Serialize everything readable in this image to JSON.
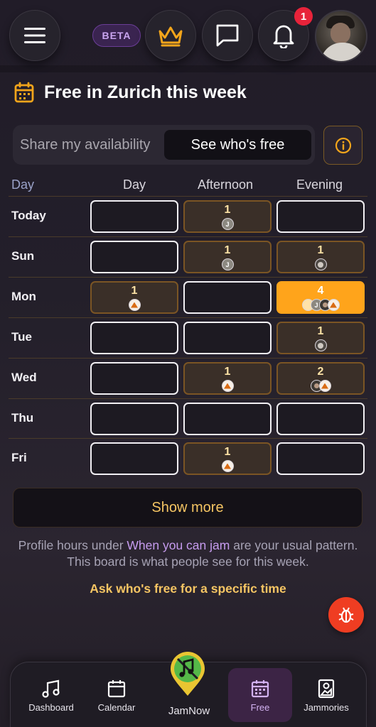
{
  "header": {
    "menu_icon": "hamburger-icon",
    "beta_label": "BETA",
    "crown_icon": "crown-icon",
    "chat_icon": "chat-icon",
    "bell_icon": "bell-icon",
    "notification_count": "1",
    "avatar_icon": "profile-avatar"
  },
  "page": {
    "title": "Free in Zurich this week",
    "title_icon": "calendar-icon"
  },
  "share": {
    "label": "Share my availability",
    "button": "See who's free",
    "info_icon": "info-icon"
  },
  "grid": {
    "headers": [
      "Day",
      "Day",
      "Afternoon",
      "Evening"
    ],
    "rows": [
      {
        "day": "Today",
        "cells": [
          {
            "count": "",
            "avatars": []
          },
          {
            "count": "1",
            "avatars": [
              "J"
            ]
          },
          {
            "count": "",
            "avatars": []
          }
        ]
      },
      {
        "day": "Sun",
        "cells": [
          {
            "count": "",
            "avatars": []
          },
          {
            "count": "1",
            "avatars": [
              "J"
            ]
          },
          {
            "count": "1",
            "avatars": [
              "dog"
            ]
          }
        ]
      },
      {
        "day": "Mon",
        "cells": [
          {
            "count": "1",
            "avatars": [
              "fox"
            ]
          },
          {
            "count": "",
            "avatars": []
          },
          {
            "count": "4",
            "avatars": [
              "blank",
              "J",
              "person",
              "fox"
            ],
            "highlight": true
          }
        ]
      },
      {
        "day": "Tue",
        "cells": [
          {
            "count": "",
            "avatars": []
          },
          {
            "count": "",
            "avatars": []
          },
          {
            "count": "1",
            "avatars": [
              "dog"
            ]
          }
        ]
      },
      {
        "day": "Wed",
        "cells": [
          {
            "count": "",
            "avatars": []
          },
          {
            "count": "1",
            "avatars": [
              "fox"
            ]
          },
          {
            "count": "2",
            "avatars": [
              "person",
              "fox"
            ]
          }
        ]
      },
      {
        "day": "Thu",
        "cells": [
          {
            "count": "",
            "avatars": []
          },
          {
            "count": "",
            "avatars": []
          },
          {
            "count": "",
            "avatars": []
          }
        ]
      },
      {
        "day": "Fri",
        "cells": [
          {
            "count": "",
            "avatars": []
          },
          {
            "count": "1",
            "avatars": [
              "fox"
            ]
          },
          {
            "count": "",
            "avatars": []
          }
        ]
      }
    ]
  },
  "show_more": "Show more",
  "note": {
    "pre": "Profile hours under ",
    "link": "When you can jam",
    "post": " are your usual pattern. This board is what people see for this week."
  },
  "ask": "Ask who's free for a specific time",
  "bug_icon": "bug-icon",
  "nav": {
    "dashboard": "Dashboard",
    "calendar": "Calendar",
    "jamnow": "JamNow",
    "free": "Free",
    "jammories": "Jammories"
  },
  "colors": {
    "accent_orange": "#ffa41b",
    "accent_purple": "#c79cf0",
    "notification_red": "#e8233a"
  }
}
